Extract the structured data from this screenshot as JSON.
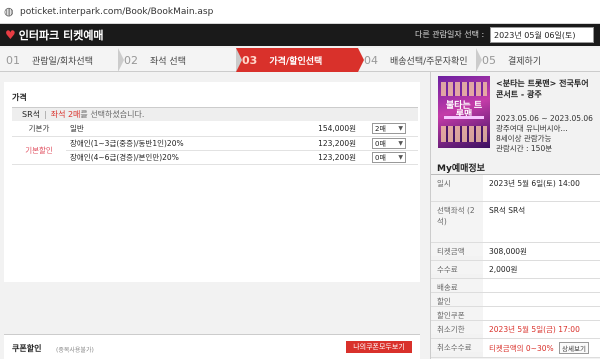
{
  "browser": {
    "url": "poticket.interpark.com/Book/BookMain.asp"
  },
  "header": {
    "logo_text": "인터파크 티켓예매",
    "date_label": "다른 관람일자 선택 :",
    "date_value": "2023년 05월 06일(토)"
  },
  "steps": [
    {
      "num": "01",
      "label": "관람일/회차선택"
    },
    {
      "num": "02",
      "label": "좌석 선택"
    },
    {
      "num": "03",
      "label": "가격/할인선택"
    },
    {
      "num": "04",
      "label": "배송선택/주문자확인"
    },
    {
      "num": "05",
      "label": "결제하기"
    }
  ],
  "price_panel": {
    "title": "가격",
    "seat_grade": "SR석",
    "seat_msg_red": "좌석 2매",
    "seat_msg_rest": "를 선택하셨습니다.",
    "rows": [
      {
        "label": "기본가",
        "name": "일반",
        "amount": "154,000원",
        "select": "2매"
      },
      {
        "label": "기본할인",
        "name": "장애인(1~3급(중증)/동반1인)20%",
        "amount": "123,200원",
        "select": "0매"
      },
      {
        "label": "",
        "name": "장애인(4~6급(경증)/본인만)20%",
        "amount": "123,200원",
        "select": "0매"
      }
    ]
  },
  "coupon": {
    "title": "쿠폰할인",
    "sub": "(중복사용불가)",
    "button": "나의쿠폰모두보기"
  },
  "side": {
    "event_title": "<분타는 트롯맨> 전국투어 콘서트 - 광주",
    "poster_text": "불타는 트롯맨",
    "dates": "2023.05.06 ~ 2023.05.06",
    "venue": "광주여대 유니버시아...",
    "age": "8세이상 관람가능",
    "duration": "관람시간 : 150분",
    "my_title": "My예매정보",
    "info": [
      {
        "k": "일시",
        "v": "2023년 5월 6일(토) 14:00"
      },
      {
        "k": "선택좌석 (2석)",
        "v": "SR석 SR석"
      },
      {
        "k": "티켓금액",
        "v": "308,000원"
      },
      {
        "k": "수수료",
        "v": "2,000원"
      },
      {
        "k": "배송료",
        "v": ""
      },
      {
        "k": "할인",
        "v": ""
      },
      {
        "k": "할인쿠폰",
        "v": ""
      },
      {
        "k": "취소기한",
        "v": "2023년 5월 5일(금) 17:00"
      },
      {
        "k": "취소수수료",
        "v": "티켓금액의 0~30%",
        "btn": "상세보기"
      }
    ]
  }
}
